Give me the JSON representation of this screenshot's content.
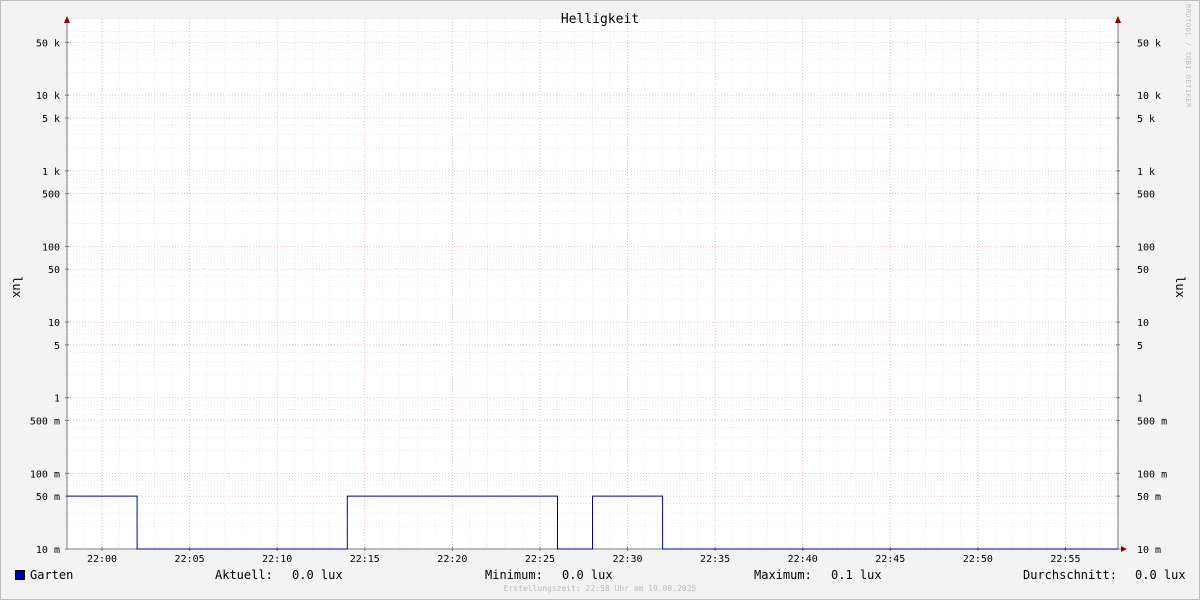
{
  "chart_data": {
    "type": "line",
    "title": "Helligkeit",
    "ylabel": "lux",
    "y_scale": "log",
    "ylim": [
      0.01,
      75000
    ],
    "y_ticks": [
      {
        "value": 50000,
        "label": "50 k"
      },
      {
        "value": 10000,
        "label": "10 k"
      },
      {
        "value": 5000,
        "label": "5 k"
      },
      {
        "value": 1000,
        "label": "1 k"
      },
      {
        "value": 500,
        "label": "500"
      },
      {
        "value": 100,
        "label": "100"
      },
      {
        "value": 50,
        "label": "50"
      },
      {
        "value": 10,
        "label": "10"
      },
      {
        "value": 5,
        "label": "5"
      },
      {
        "value": 1,
        "label": "1"
      },
      {
        "value": 0.5,
        "label": "500 m"
      },
      {
        "value": 0.1,
        "label": "100 m"
      },
      {
        "value": 0.05,
        "label": "50 m"
      },
      {
        "value": 0.01,
        "label": "10 m"
      }
    ],
    "xlim": [
      "21:58",
      "22:58"
    ],
    "x_ticks": [
      "22:00",
      "22:05",
      "22:10",
      "22:15",
      "22:20",
      "22:25",
      "22:30",
      "22:35",
      "22:40",
      "22:45",
      "22:50",
      "22:55"
    ],
    "grid": true,
    "series": [
      {
        "name": "Garten",
        "color": "#0000a0",
        "x": [
          "21:58",
          "22:02",
          "22:02",
          "22:14",
          "22:14",
          "22:26",
          "22:26",
          "22:28",
          "22:28",
          "22:32",
          "22:32",
          "22:58"
        ],
        "values": [
          0.05,
          0.05,
          0.01,
          0.01,
          0.05,
          0.05,
          0.01,
          0.01,
          0.05,
          0.05,
          0.01,
          0.01
        ]
      }
    ]
  },
  "legend": {
    "series_name": "Garten",
    "current_label": "Aktuell:",
    "current_value": "0.0 lux",
    "min_label": "Minimum:",
    "min_value": "0.0 lux",
    "max_label": "Maximum:",
    "max_value": "0.1 lux",
    "avg_label": "Durchschnitt:",
    "avg_value": "0.0 lux"
  },
  "footer": "Erstellungszeit: 22:58 Uhr am 19.08.2025",
  "watermark": "RRDTOOL / TOBI OETIKER"
}
